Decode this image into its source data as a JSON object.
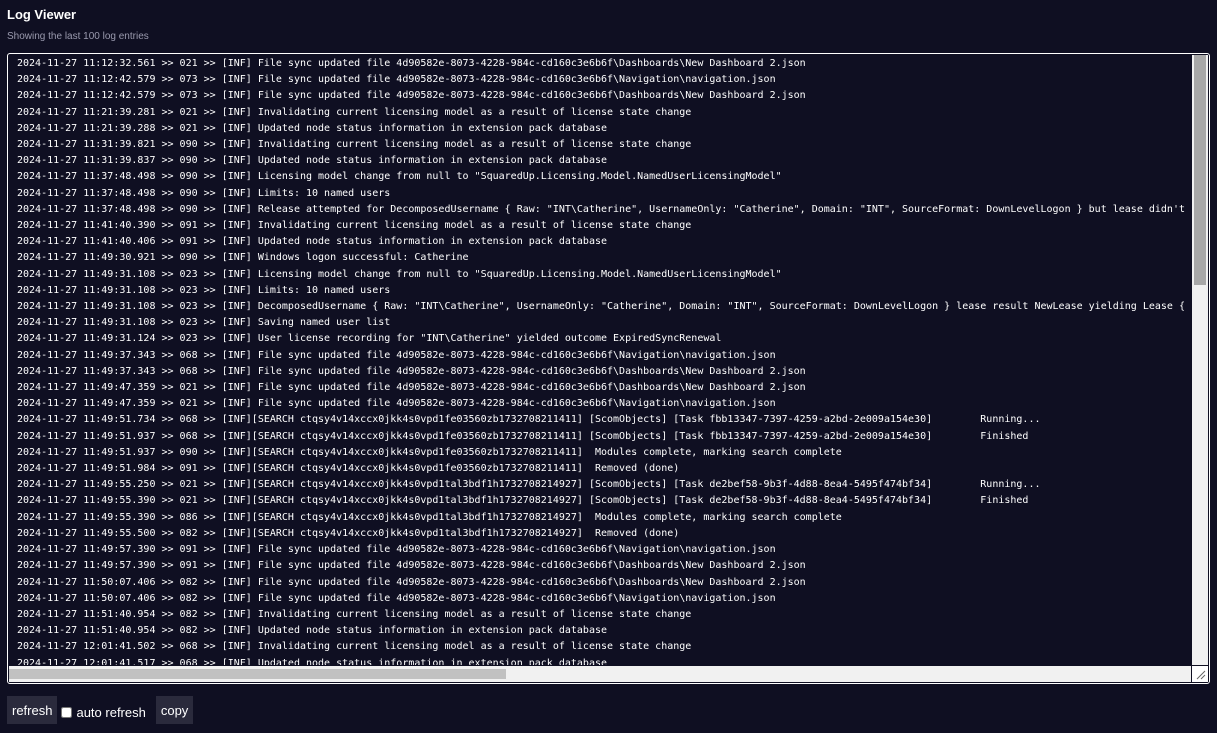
{
  "header": {
    "title": "Log Viewer",
    "subtitle": "Showing the last 100 log entries"
  },
  "log": {
    "lines": [
      "2024-11-27 11:12:32.561 >> 021 >> [INF] File sync updated file 4d90582e-8073-4228-984c-cd160c3e6b6f\\Dashboards\\New Dashboard 2.json",
      "2024-11-27 11:12:42.579 >> 073 >> [INF] File sync updated file 4d90582e-8073-4228-984c-cd160c3e6b6f\\Navigation\\navigation.json",
      "2024-11-27 11:12:42.579 >> 073 >> [INF] File sync updated file 4d90582e-8073-4228-984c-cd160c3e6b6f\\Dashboards\\New Dashboard 2.json",
      "2024-11-27 11:21:39.281 >> 021 >> [INF] Invalidating current licensing model as a result of license state change",
      "2024-11-27 11:21:39.288 >> 021 >> [INF] Updated node status information in extension pack database",
      "2024-11-27 11:31:39.821 >> 090 >> [INF] Invalidating current licensing model as a result of license state change",
      "2024-11-27 11:31:39.837 >> 090 >> [INF] Updated node status information in extension pack database",
      "2024-11-27 11:37:48.498 >> 090 >> [INF] Licensing model change from null to \"SquaredUp.Licensing.Model.NamedUserLicensingModel\"",
      "2024-11-27 11:37:48.498 >> 090 >> [INF] Limits: 10 named users",
      "2024-11-27 11:37:48.498 >> 090 >> [INF] Release attempted for DecomposedUsername { Raw: \"INT\\Catherine\", UsernameOnly: \"Catherine\", Domain: \"INT\", SourceFormat: DownLevelLogon } but lease didn't exi",
      "2024-11-27 11:41:40.390 >> 091 >> [INF] Invalidating current licensing model as a result of license state change",
      "2024-11-27 11:41:40.406 >> 091 >> [INF] Updated node status information in extension pack database",
      "2024-11-27 11:49:30.921 >> 090 >> [INF] Windows logon successful: Catherine",
      "2024-11-27 11:49:31.108 >> 023 >> [INF] Licensing model change from null to \"SquaredUp.Licensing.Model.NamedUserLicensingModel\"",
      "2024-11-27 11:49:31.108 >> 023 >> [INF] Limits: 10 named users",
      "2024-11-27 11:49:31.108 >> 023 >> [INF] DecomposedUsername { Raw: \"INT\\Catherine\", UsernameOnly: \"Catherine\", Domain: \"INT\", SourceFormat: DownLevelLogon } lease result NewLease yielding Lease { Exp",
      "2024-11-27 11:49:31.108 >> 023 >> [INF] Saving named user list",
      "2024-11-27 11:49:31.124 >> 023 >> [INF] User license recording for \"INT\\Catherine\" yielded outcome ExpiredSyncRenewal",
      "2024-11-27 11:49:37.343 >> 068 >> [INF] File sync updated file 4d90582e-8073-4228-984c-cd160c3e6b6f\\Navigation\\navigation.json",
      "2024-11-27 11:49:37.343 >> 068 >> [INF] File sync updated file 4d90582e-8073-4228-984c-cd160c3e6b6f\\Dashboards\\New Dashboard 2.json",
      "2024-11-27 11:49:47.359 >> 021 >> [INF] File sync updated file 4d90582e-8073-4228-984c-cd160c3e6b6f\\Dashboards\\New Dashboard 2.json",
      "2024-11-27 11:49:47.359 >> 021 >> [INF] File sync updated file 4d90582e-8073-4228-984c-cd160c3e6b6f\\Navigation\\navigation.json",
      "2024-11-27 11:49:51.734 >> 068 >> [INF][SEARCH ctqsy4v14xccx0jkk4s0vpd1fe03560zb1732708211411] [ScomObjects] [Task fbb13347-7397-4259-a2bd-2e009a154e30]        Running...",
      "2024-11-27 11:49:51.937 >> 068 >> [INF][SEARCH ctqsy4v14xccx0jkk4s0vpd1fe03560zb1732708211411] [ScomObjects] [Task fbb13347-7397-4259-a2bd-2e009a154e30]        Finished",
      "2024-11-27 11:49:51.937 >> 090 >> [INF][SEARCH ctqsy4v14xccx0jkk4s0vpd1fe03560zb1732708211411]  Modules complete, marking search complete",
      "2024-11-27 11:49:51.984 >> 091 >> [INF][SEARCH ctqsy4v14xccx0jkk4s0vpd1fe03560zb1732708211411]  Removed (done)",
      "2024-11-27 11:49:55.250 >> 021 >> [INF][SEARCH ctqsy4v14xccx0jkk4s0vpd1tal3bdf1h1732708214927] [ScomObjects] [Task de2bef58-9b3f-4d88-8ea4-5495f474bf34]        Running...",
      "2024-11-27 11:49:55.390 >> 021 >> [INF][SEARCH ctqsy4v14xccx0jkk4s0vpd1tal3bdf1h1732708214927] [ScomObjects] [Task de2bef58-9b3f-4d88-8ea4-5495f474bf34]        Finished",
      "2024-11-27 11:49:55.390 >> 086 >> [INF][SEARCH ctqsy4v14xccx0jkk4s0vpd1tal3bdf1h1732708214927]  Modules complete, marking search complete",
      "2024-11-27 11:49:55.500 >> 082 >> [INF][SEARCH ctqsy4v14xccx0jkk4s0vpd1tal3bdf1h1732708214927]  Removed (done)",
      "2024-11-27 11:49:57.390 >> 091 >> [INF] File sync updated file 4d90582e-8073-4228-984c-cd160c3e6b6f\\Navigation\\navigation.json",
      "2024-11-27 11:49:57.390 >> 091 >> [INF] File sync updated file 4d90582e-8073-4228-984c-cd160c3e6b6f\\Dashboards\\New Dashboard 2.json",
      "2024-11-27 11:50:07.406 >> 082 >> [INF] File sync updated file 4d90582e-8073-4228-984c-cd160c3e6b6f\\Dashboards\\New Dashboard 2.json",
      "2024-11-27 11:50:07.406 >> 082 >> [INF] File sync updated file 4d90582e-8073-4228-984c-cd160c3e6b6f\\Navigation\\navigation.json",
      "2024-11-27 11:51:40.954 >> 082 >> [INF] Invalidating current licensing model as a result of license state change",
      "2024-11-27 11:51:40.954 >> 082 >> [INF] Updated node status information in extension pack database",
      "2024-11-27 12:01:41.502 >> 068 >> [INF] Invalidating current licensing model as a result of license state change",
      "2024-11-27 12:01:41.517 >> 068 >> [INF] Updated node status information in extension pack database"
    ]
  },
  "controls": {
    "refresh_label": "refresh",
    "auto_refresh_label": "auto refresh",
    "auto_refresh_checked": false,
    "copy_label": "copy"
  }
}
